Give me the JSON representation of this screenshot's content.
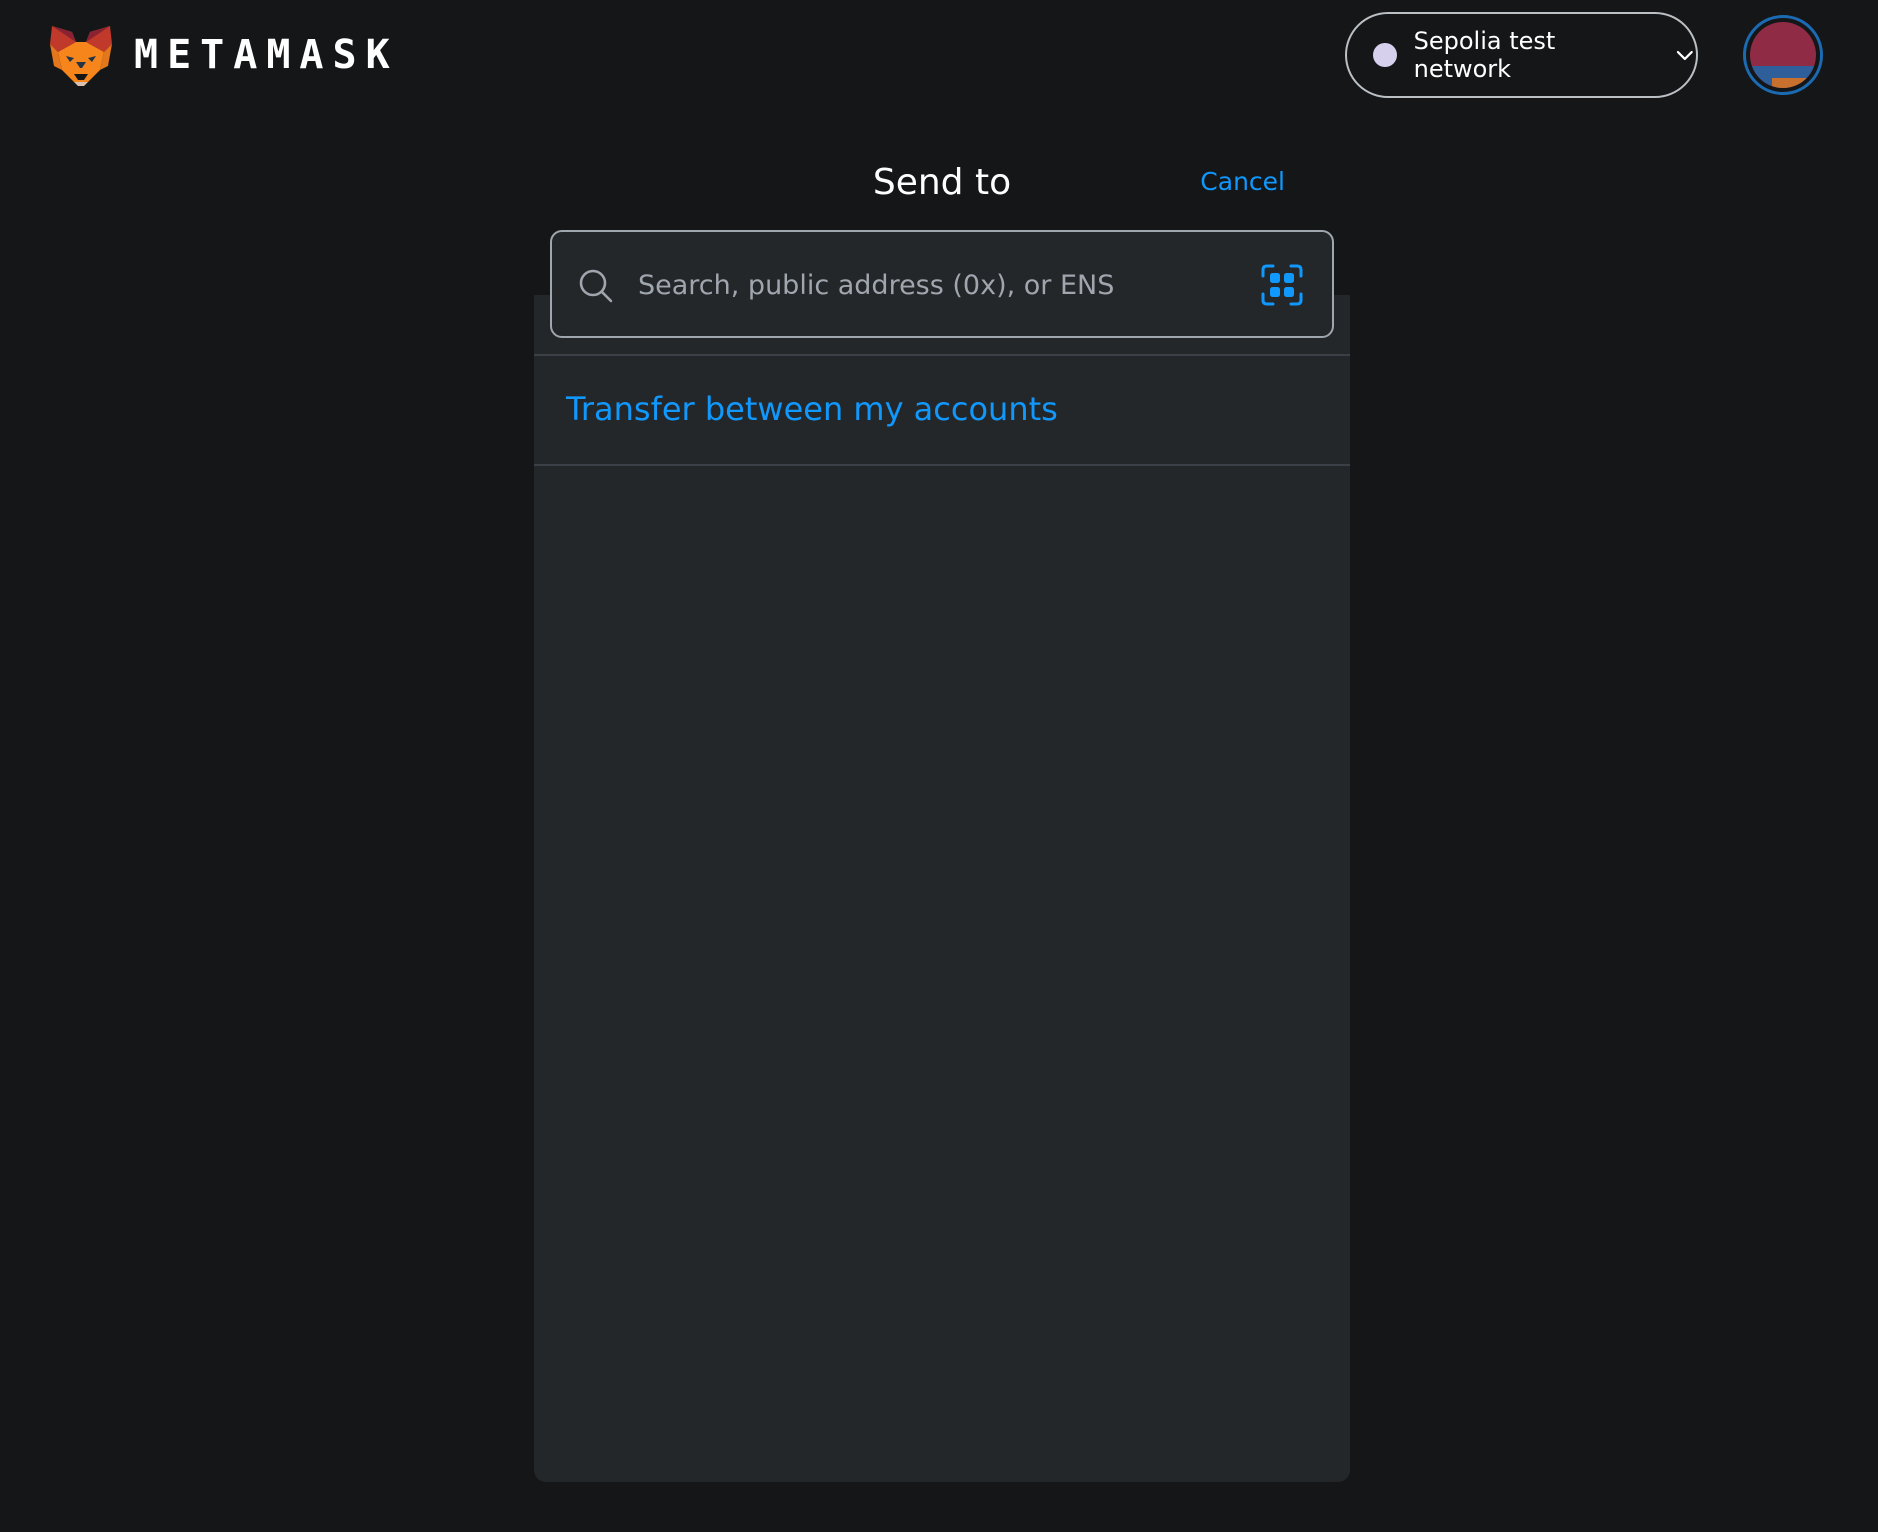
{
  "app": {
    "brand": "METAMASK",
    "logo_icon": "metamask-fox-icon"
  },
  "header": {
    "network": {
      "label": "Sepolia test network",
      "dot_color": "#d6d0ec",
      "icon": "chevron-down-icon"
    },
    "account": {
      "icon": "account-avatar"
    }
  },
  "send": {
    "title": "Send to",
    "cancel_label": "Cancel",
    "search": {
      "placeholder": "Search, public address (0x), or ENS",
      "value": "",
      "icon": "search-icon",
      "scan_icon": "qr-scan-icon"
    },
    "transfer_label": "Transfer between my accounts"
  },
  "colors": {
    "background": "#141618",
    "panel": "#24272a",
    "accent": "#1098fc",
    "text": "#ffffff",
    "muted": "#9fa6ae"
  }
}
